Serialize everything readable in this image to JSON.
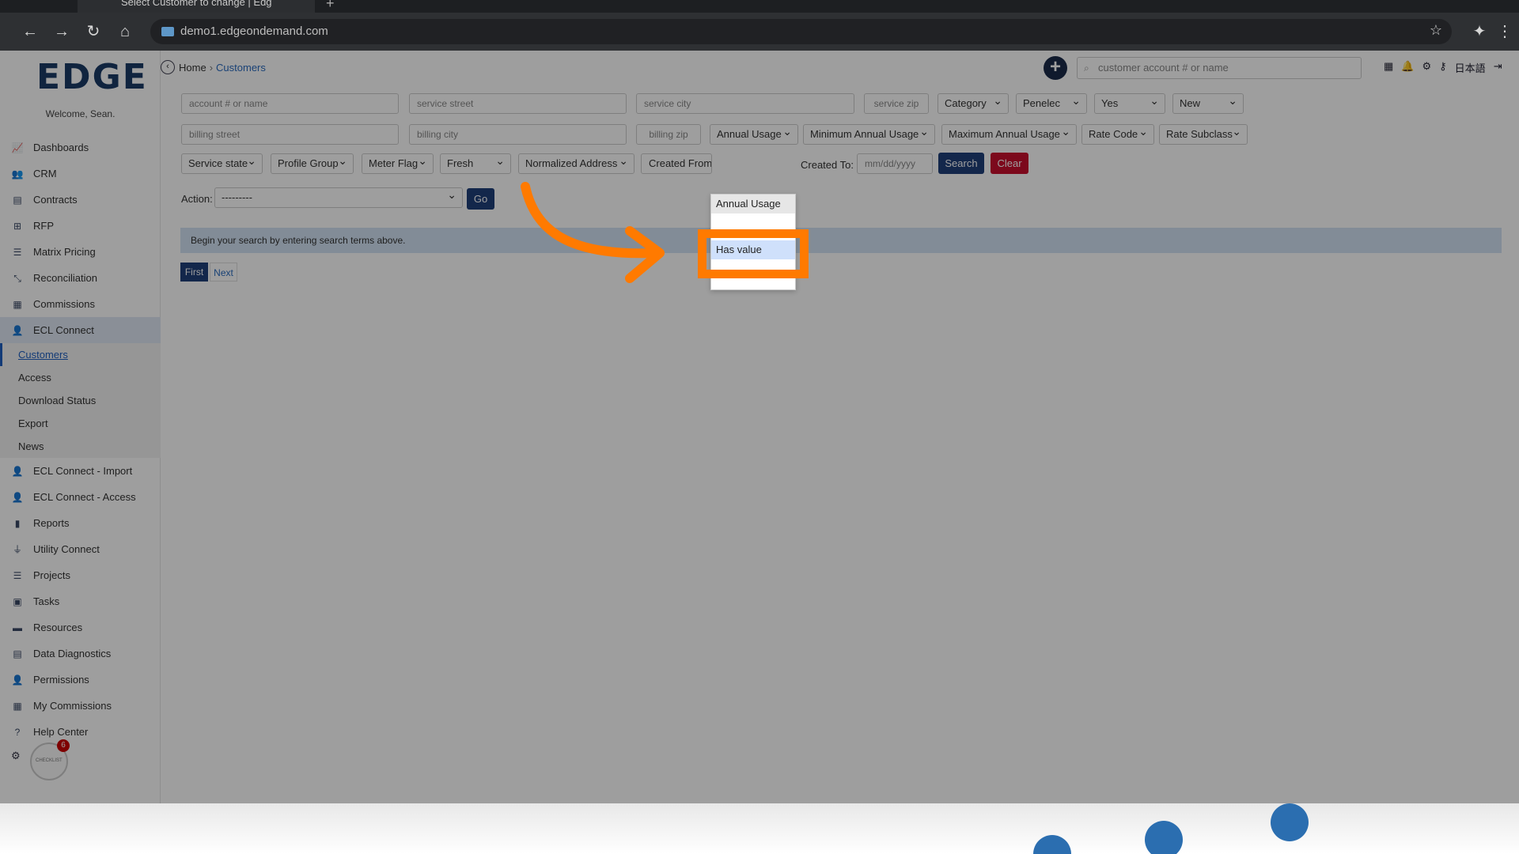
{
  "browser": {
    "tab_title": "Select Customer to change | Edg",
    "url": "demo1.edgeondemand.com"
  },
  "sidebar": {
    "logo": "EDGE",
    "welcome": "Welcome, Sean.",
    "items": [
      {
        "label": "Dashboards",
        "icon": "chart-line-icon"
      },
      {
        "label": "CRM",
        "icon": "users-icon"
      },
      {
        "label": "Contracts",
        "icon": "file-icon"
      },
      {
        "label": "RFP",
        "icon": "sitemap-icon"
      },
      {
        "label": "Matrix Pricing",
        "icon": "list-icon"
      },
      {
        "label": "Reconciliation",
        "icon": "compress-icon"
      },
      {
        "label": "Commissions",
        "icon": "money-icon"
      },
      {
        "label": "ECL Connect",
        "icon": "user-connect-icon"
      }
    ],
    "subitems": [
      "Customers",
      "Access",
      "Download Status",
      "Export",
      "News"
    ],
    "items_after": [
      {
        "label": "ECL Connect - Import",
        "icon": "user-connect-icon"
      },
      {
        "label": "ECL Connect - Access",
        "icon": "user-connect-icon"
      },
      {
        "label": "Reports",
        "icon": "bar-chart-icon"
      },
      {
        "label": "Utility Connect",
        "icon": "plug-icon"
      },
      {
        "label": "Projects",
        "icon": "tasks-icon"
      },
      {
        "label": "Tasks",
        "icon": "book-icon"
      },
      {
        "label": "Resources",
        "icon": "folder-icon"
      },
      {
        "label": "Data Diagnostics",
        "icon": "server-icon"
      },
      {
        "label": "Permissions",
        "icon": "user-icon"
      },
      {
        "label": "My Commissions",
        "icon": "money-icon"
      },
      {
        "label": "Help Center",
        "icon": "question-icon"
      }
    ],
    "badge_count": "6",
    "badge_text": "CHECKLIST"
  },
  "header": {
    "breadcrumb_home": "Home",
    "breadcrumb_sep": "›",
    "breadcrumb_current": "Customers",
    "search_placeholder": "customer account # or name",
    "lang": "日本語"
  },
  "filters": {
    "account_placeholder": "account # or name",
    "service_street_placeholder": "service street",
    "service_city_placeholder": "service city",
    "service_zip_placeholder": "service zip",
    "category": "Category",
    "utility": "Penelec",
    "yes": "Yes",
    "status": "New",
    "billing_street_placeholder": "billing street",
    "billing_city_placeholder": "billing city",
    "billing_zip_placeholder": "billing zip",
    "annual_usage": "Annual Usage",
    "min_annual_usage": "Minimum Annual Usage",
    "max_annual_usage": "Maximum Annual Usage",
    "rate_code": "Rate Code",
    "rate_subclass": "Rate Subclass",
    "service_state": "Service state",
    "profile_group": "Profile Group",
    "meter_flag": "Meter Flag",
    "fresh": "Fresh",
    "normalized_address": "Normalized Address",
    "created_from": "Created From:",
    "created_to": "Created To:",
    "date_placeholder": "mm/dd/yyyy",
    "search_button": "Search",
    "clear_button": "Clear"
  },
  "action": {
    "label": "Action:",
    "value": "---------",
    "go_button": "Go"
  },
  "info": "Begin your search by entering search terms above.",
  "pagination": {
    "first": "First",
    "next": "Next"
  },
  "dropdown": {
    "options": [
      "Annual Usage",
      "Has value"
    ],
    "selected": "Has value"
  },
  "colors": {
    "highlight": "#ff7a00",
    "primary": "#1f3f7a",
    "danger": "#c8102e",
    "info_bg": "#d2e3f4"
  }
}
